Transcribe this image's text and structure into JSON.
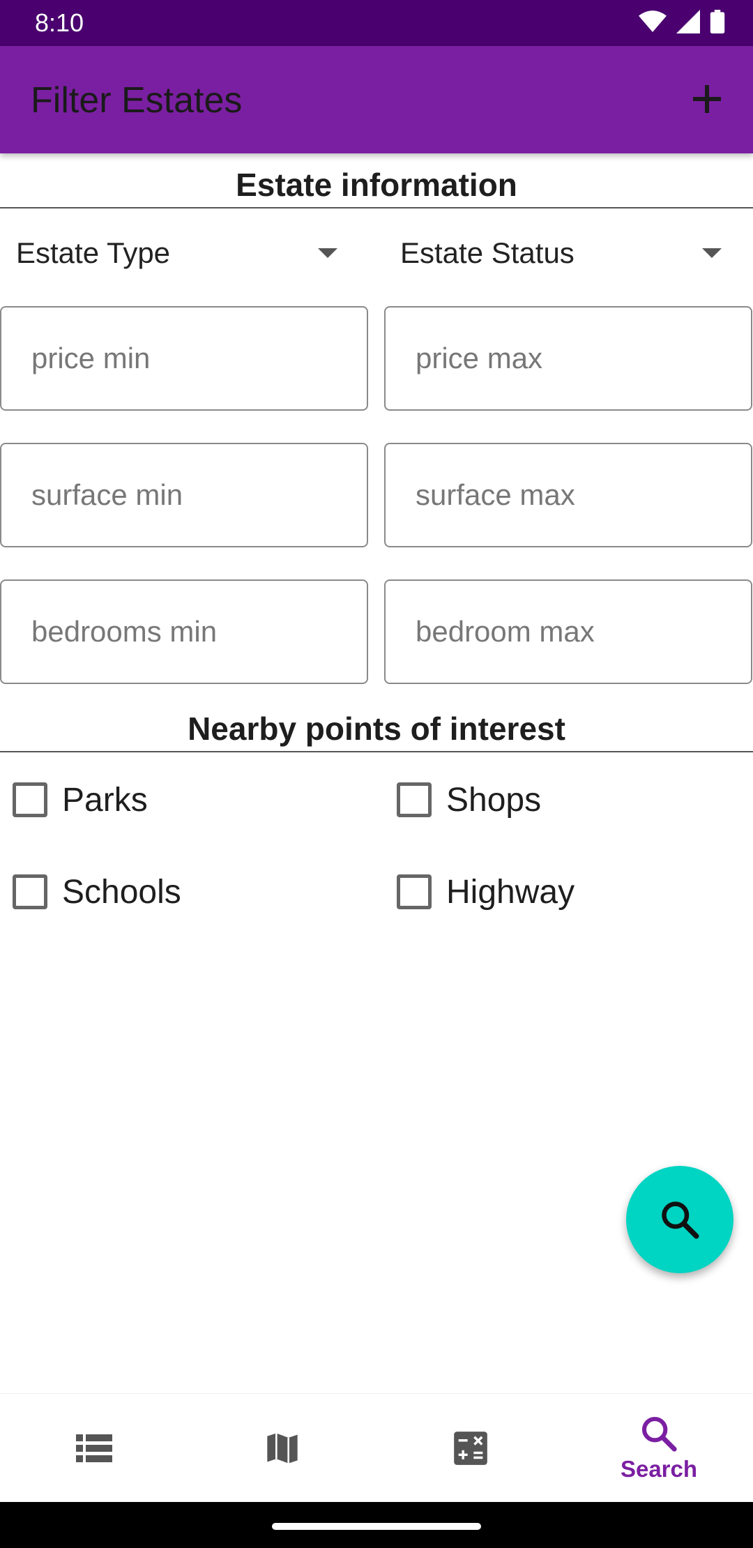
{
  "status_bar": {
    "time": "8:10"
  },
  "app_bar": {
    "title": "Filter Estates"
  },
  "estate_section": {
    "title": "Estate information",
    "type_dropdown": "Estate Type",
    "status_dropdown": "Estate Status",
    "fields": {
      "price_min": "price min",
      "price_max": "price max",
      "surface_min": "surface min",
      "surface_max": "surface max",
      "bedrooms_min": "bedrooms min",
      "bedrooms_max": "bedroom max"
    }
  },
  "poi_section": {
    "title": "Nearby points of interest",
    "items": [
      "Parks",
      "Shops",
      "Schools",
      "Highway"
    ]
  },
  "bottom_nav": {
    "items": [
      {
        "icon": "list-icon",
        "label": ""
      },
      {
        "icon": "map-icon",
        "label": ""
      },
      {
        "icon": "calculator-icon",
        "label": ""
      },
      {
        "icon": "search-icon",
        "label": "Search"
      }
    ],
    "active_color": "#7b1fa2"
  },
  "colors": {
    "status_bar": "#4a006e",
    "app_bar": "#7b1fa2",
    "fab": "#00d4c2"
  }
}
